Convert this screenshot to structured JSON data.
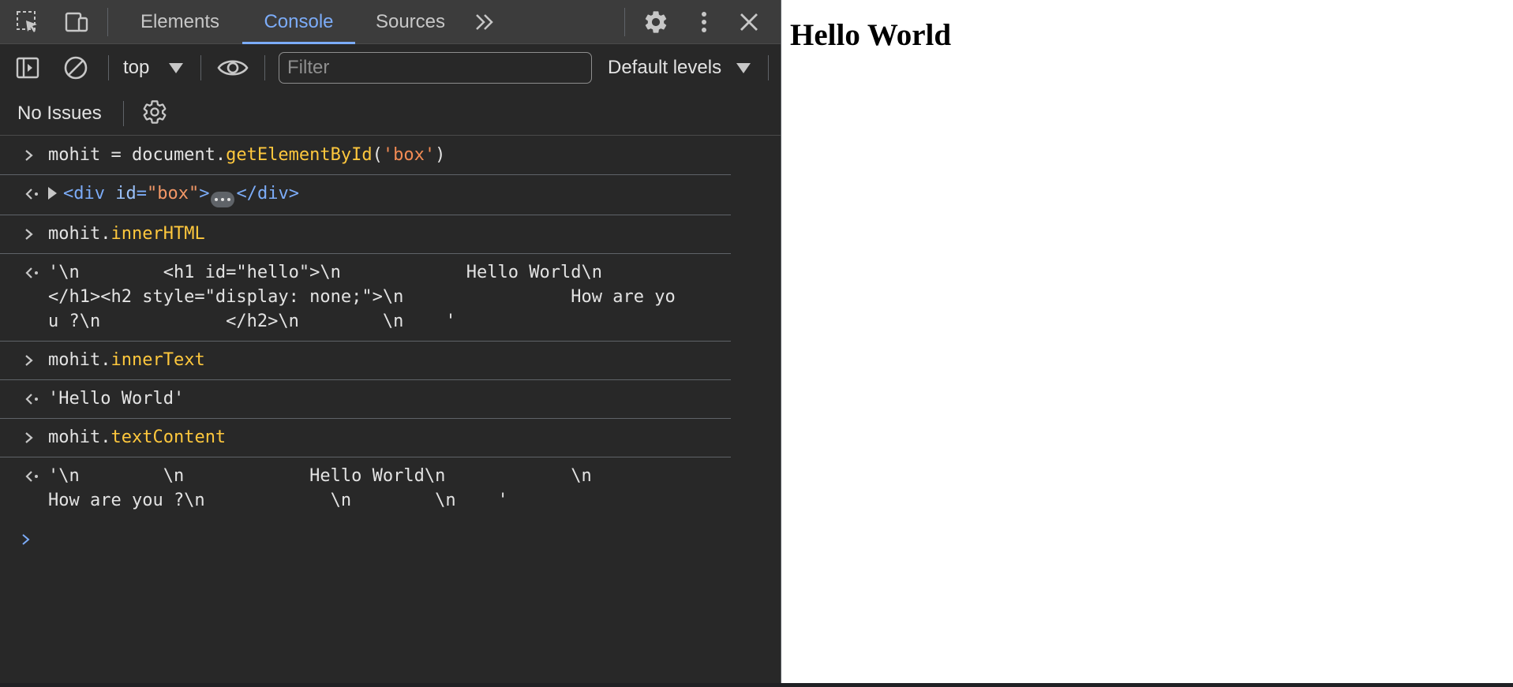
{
  "devtools": {
    "tabs": [
      {
        "label": "Elements",
        "active": false
      },
      {
        "label": "Console",
        "active": true
      },
      {
        "label": "Sources",
        "active": false
      }
    ],
    "toolbar": {
      "context_label": "top",
      "filter_placeholder": "Filter",
      "levels_label": "Default levels"
    },
    "issues": {
      "label": "No Issues"
    },
    "colors": {
      "accent": "#7cacf8",
      "background": "#282828",
      "property": "#ffc83d",
      "output_string": "#5cd5fb"
    },
    "icons": [
      "inspect-element-icon",
      "device-toolbar-icon",
      "more-tabs-icon",
      "settings-icon",
      "more-options-icon",
      "close-icon",
      "sidebar-toggle-icon",
      "clear-console-icon",
      "live-expression-icon"
    ]
  },
  "console": {
    "e1": {
      "pre": "mohit = document.",
      "method": "getElementById",
      "open": "(",
      "arg": "'box'",
      "close": ")"
    },
    "r1": {
      "open": "<div ",
      "attr": "id",
      "eq": "=",
      "val": "\"box\"",
      "gt": ">",
      "end": "</div>"
    },
    "e2": {
      "obj": "mohit.",
      "prop": "innerHTML"
    },
    "r2": {
      "text": "'\\n        <h1 id=\"hello\">\\n            Hello World\\n        \n</h1><h2 style=\"display: none;\">\\n                How are yo\nu ?\\n            </h2>\\n        \\n    '"
    },
    "e3": {
      "obj": "mohit.",
      "prop": "innerText"
    },
    "r3": {
      "text": "'Hello World'"
    },
    "e4": {
      "obj": "mohit.",
      "prop": "textContent"
    },
    "r4": {
      "text": "'\\n        \\n            Hello World\\n            \\n        \nHow are you ?\\n            \\n        \\n    '"
    }
  },
  "page": {
    "heading": "Hello World"
  }
}
